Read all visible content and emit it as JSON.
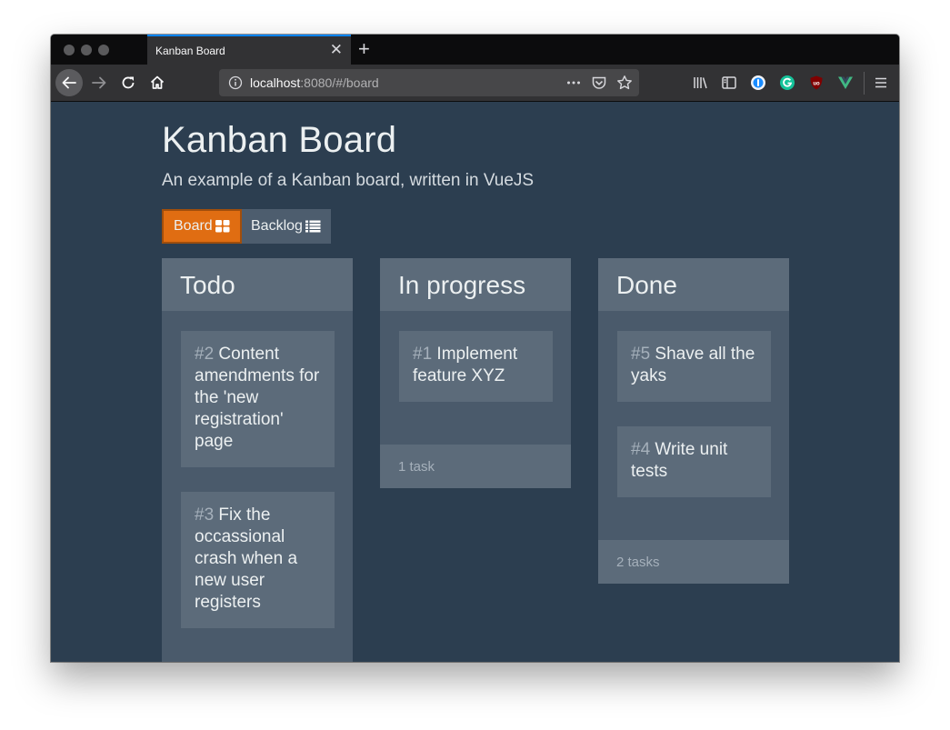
{
  "browser": {
    "tab_title": "Kanban Board",
    "url_host": "localhost",
    "url_rest": ":8080/#/board",
    "icons": [
      "back-icon",
      "forward-icon",
      "reload-icon",
      "home-icon",
      "info-icon",
      "more-icon",
      "pocket-icon",
      "bookmark-star-icon",
      "library-icon",
      "sidebar-icon",
      "extension-1password-icon",
      "extension-grammarly-icon",
      "extension-ublock-icon",
      "extension-vue-icon",
      "menu-icon"
    ]
  },
  "page": {
    "title": "Kanban Board",
    "subtitle": "An example of a Kanban board, written in VueJS",
    "nav": {
      "board_label": "Board",
      "backlog_label": "Backlog"
    }
  },
  "board": {
    "columns": [
      {
        "title": "Todo",
        "cards": [
          {
            "num": "#2",
            "text": "Content amendments for the 'new registration' page"
          },
          {
            "num": "#3",
            "text": "Fix the occassional crash when a new user registers"
          }
        ],
        "footer": ""
      },
      {
        "title": "In progress",
        "cards": [
          {
            "num": "#1",
            "text": "Implement feature XYZ"
          }
        ],
        "footer": "1 task"
      },
      {
        "title": "Done",
        "cards": [
          {
            "num": "#5",
            "text": "Shave all the yaks"
          },
          {
            "num": "#4",
            "text": "Write unit tests"
          }
        ],
        "footer": "2 tasks"
      }
    ]
  },
  "colors": {
    "page_bg": "#2c3e50",
    "accent": "#e06d12",
    "column_bg": "#4a5a6b",
    "card_bg": "#5c6b7a"
  }
}
